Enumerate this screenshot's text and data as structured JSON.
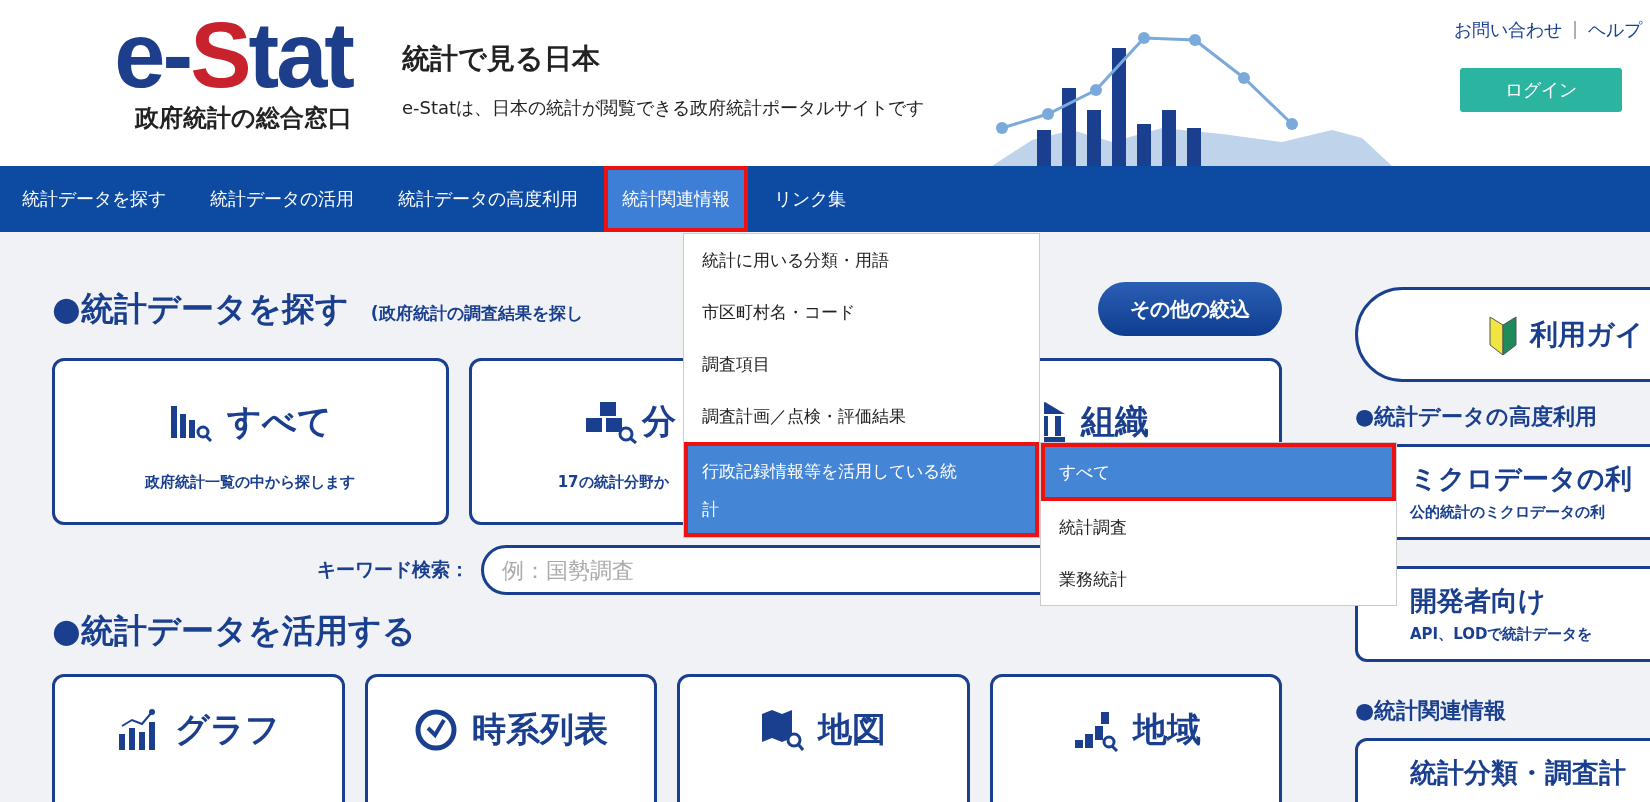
{
  "logo": {
    "before": "e-",
    "highlight": "S",
    "after": "tat",
    "tagline": "政府統計の総合窓口"
  },
  "site": {
    "title": "統計で見る日本",
    "subtitle": "e-Statは、日本の統計が閲覧できる政府統計ポータルサイトです"
  },
  "top_links": [
    "お問い合わせ",
    "ヘルプ"
  ],
  "top_links_separator": "|",
  "login_button": "ログイン",
  "nav": [
    {
      "label": "統計データを探す",
      "selected": false
    },
    {
      "label": "統計データの活用",
      "selected": false
    },
    {
      "label": "統計データの高度利用",
      "selected": false
    },
    {
      "label": "統計関連情報",
      "selected": true
    },
    {
      "label": "リンク集",
      "selected": false
    }
  ],
  "dropdown": [
    {
      "label": "統計に用いる分類・用語",
      "selected": false
    },
    {
      "label": "市区町村名・コード",
      "selected": false
    },
    {
      "label": "調査項目",
      "selected": false
    },
    {
      "label": "調査計画／点検・評価結果",
      "selected": false
    },
    {
      "label": "行政記録情報等を活用している統計",
      "selected": true
    }
  ],
  "submenu": [
    {
      "label": "すべて",
      "selected": true
    },
    {
      "label": "統計調査",
      "selected": false
    },
    {
      "label": "業務統計",
      "selected": false
    }
  ],
  "search_section": {
    "heading": "●統計データを探す",
    "note": "(政府統計の調査結果を探し",
    "filter_button": "その他の絞込",
    "cards": [
      {
        "title": "すべて",
        "subtitle": "政府統計一覧の中から探します"
      },
      {
        "title": "分",
        "subtitle": "17の統計分野か"
      },
      {
        "title": "組織"
      }
    ],
    "keyword_label": "キーワード検索：",
    "keyword_placeholder": "例：国勢調査"
  },
  "use_section": {
    "heading": "●統計データを活用する",
    "cards": [
      {
        "title": "グラフ"
      },
      {
        "title": "時系列表"
      },
      {
        "title": "地図"
      },
      {
        "title": "地域"
      }
    ]
  },
  "sidebar": {
    "guide_button": "利用ガイ",
    "advanced_heading": "●統計データの高度利用",
    "advanced_cards": [
      {
        "title": "ミクロデータの利",
        "subtitle": "公的統計のミクロデータの利"
      },
      {
        "title": "開発者向け",
        "subtitle": "API、LODで統計データを"
      }
    ],
    "related_heading": "●統計関連情報",
    "related_cards": [
      {
        "title": "統計分類・調査計"
      }
    ]
  }
}
